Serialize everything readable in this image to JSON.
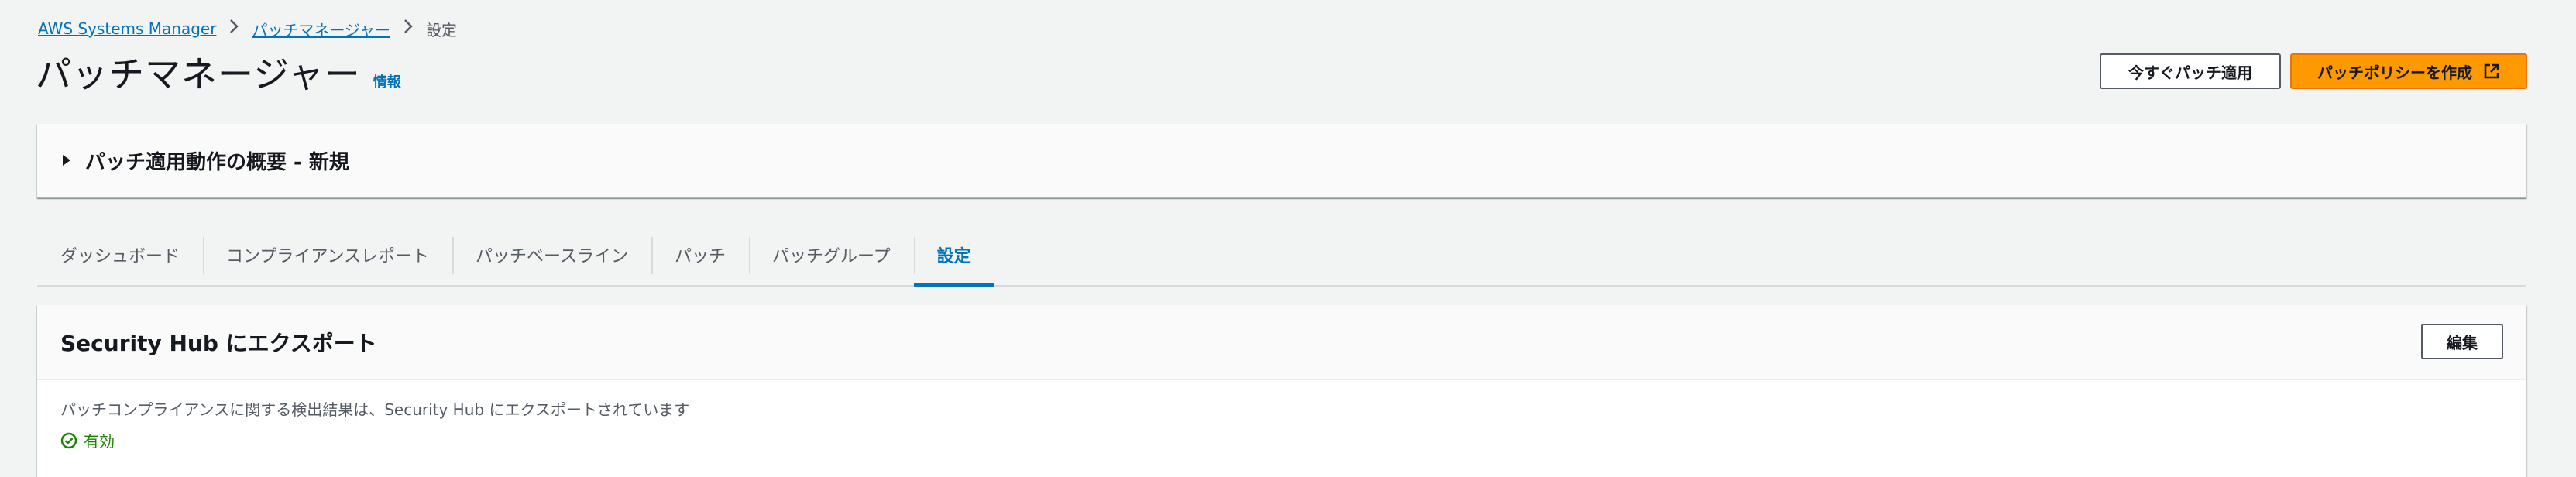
{
  "breadcrumb": {
    "items": [
      "AWS Systems Manager",
      "パッチマネージャー"
    ],
    "current": "設定"
  },
  "header": {
    "title": "パッチマネージャー",
    "info_label": "情報",
    "apply_now_label": "今すぐパッチ適用",
    "create_policy_label": "パッチポリシーを作成"
  },
  "summary": {
    "title": "パッチ適用動作の概要 - 新規"
  },
  "tabs": [
    {
      "label": "ダッシュボード"
    },
    {
      "label": "コンプライアンスレポート"
    },
    {
      "label": "パッチベースライン"
    },
    {
      "label": "パッチ"
    },
    {
      "label": "パッチグループ"
    },
    {
      "label": "設定",
      "active": true
    }
  ],
  "security_hub": {
    "title": "Security Hub にエクスポート",
    "edit_label": "編集",
    "description": "パッチコンプライアンスに関する検出結果は、Security Hub にエクスポートされています",
    "status": "有効"
  },
  "colors": {
    "link": "#0073bb",
    "primary_button": "#ff9900",
    "success": "#1d8102",
    "background": "#f2f3f3"
  },
  "icons": {
    "external_link": "external-link-icon",
    "caret": "caret-right-icon",
    "status": "check-circle-icon"
  }
}
